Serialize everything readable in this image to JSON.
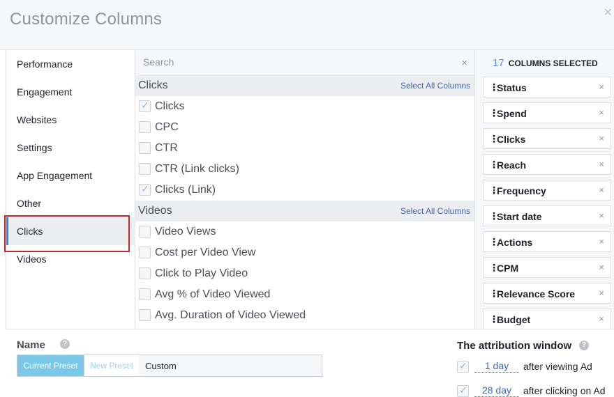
{
  "dialog": {
    "title": "Customize Columns",
    "close_icon": "close-icon"
  },
  "categories": [
    {
      "label": "Performance",
      "active": false
    },
    {
      "label": "Engagement",
      "active": false
    },
    {
      "label": "Websites",
      "active": false
    },
    {
      "label": "Settings",
      "active": false
    },
    {
      "label": "App Engagement",
      "active": false
    },
    {
      "label": "Other",
      "active": false
    },
    {
      "label": "Clicks",
      "active": true
    },
    {
      "label": "Videos",
      "active": false
    }
  ],
  "search": {
    "placeholder": "Search",
    "value": ""
  },
  "sections": [
    {
      "name": "Clicks",
      "select_all_label": "Select All Columns",
      "items": [
        {
          "label": "Clicks",
          "checked": true
        },
        {
          "label": "CPC",
          "checked": false
        },
        {
          "label": "CTR",
          "checked": false
        },
        {
          "label": "CTR (Link clicks)",
          "checked": false
        },
        {
          "label": "Clicks (Link)",
          "checked": true
        }
      ]
    },
    {
      "name": "Videos",
      "select_all_label": "Select All Columns",
      "items": [
        {
          "label": "Video Views",
          "checked": false
        },
        {
          "label": "Cost per Video View",
          "checked": false
        },
        {
          "label": "Click to Play Video",
          "checked": false
        },
        {
          "label": "Avg % of Video Viewed",
          "checked": false
        },
        {
          "label": "Avg. Duration of Video Viewed",
          "checked": false
        }
      ]
    }
  ],
  "selected": {
    "count": "17",
    "label": "COLUMNS SELECTED",
    "grip_glyph": "⋮",
    "remove_glyph": "×",
    "columns": [
      "Status",
      "Spend",
      "Clicks",
      "Reach",
      "Frequency",
      "Start date",
      "Actions",
      "CPM",
      "Relevance Score",
      "Budget"
    ]
  },
  "preset": {
    "name_label": "Name",
    "help_glyph": "?",
    "current_label": "Current Preset",
    "new_label": "New Preset",
    "value": "Custom"
  },
  "attribution": {
    "label": "The attribution window",
    "help_glyph": "?",
    "rows": [
      {
        "days": "1 day",
        "after": "after viewing Ad"
      },
      {
        "days": "28 day",
        "after": "after clicking on Ad"
      }
    ]
  },
  "colors": {
    "accent": "#4267b2",
    "count": "#5890ff",
    "active_border": "#4080ff",
    "highlight": "#c0282d",
    "preset_current": "#7ac8ea"
  }
}
